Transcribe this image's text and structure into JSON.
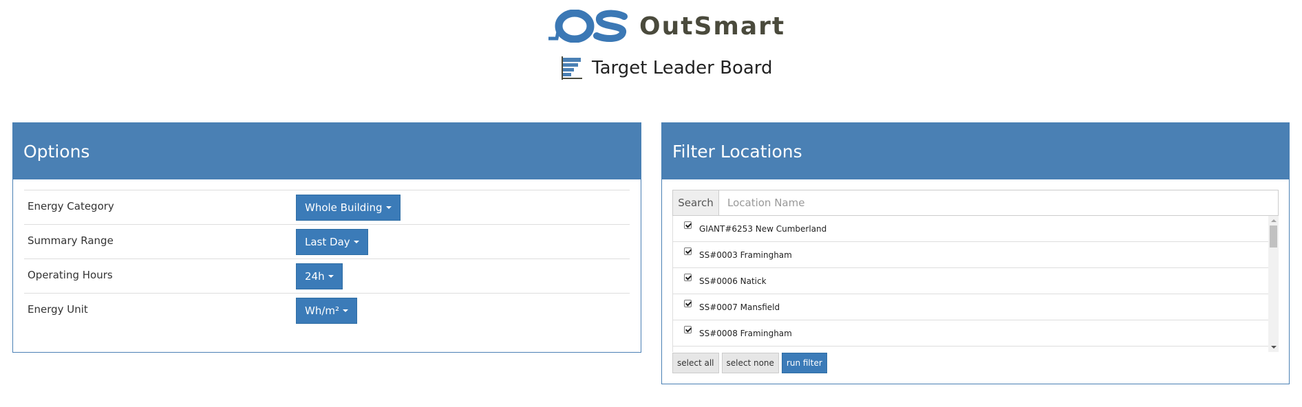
{
  "brand": {
    "name": "OutSmart",
    "logo_icon": "outsmart-os-logo",
    "color": "#4a80b4"
  },
  "page": {
    "title": "Target Leader Board",
    "title_icon": "leaderboard-icon"
  },
  "options": {
    "heading": "Options",
    "rows": [
      {
        "label": "Energy Category",
        "value": "Whole Building"
      },
      {
        "label": "Summary Range",
        "value": "Last Day"
      },
      {
        "label": "Operating Hours",
        "value": "24h"
      },
      {
        "label": "Energy Unit",
        "value": "Wh/m²"
      }
    ]
  },
  "filter": {
    "heading": "Filter Locations",
    "search_label": "Search",
    "search_placeholder": "Location Name",
    "locations": [
      {
        "name": "GIANT#6253 New Cumberland",
        "checked": true
      },
      {
        "name": "SS#0003 Framingham",
        "checked": true
      },
      {
        "name": "SS#0006 Natick",
        "checked": true
      },
      {
        "name": "SS#0007 Mansfield",
        "checked": true
      },
      {
        "name": "SS#0008 Framingham",
        "checked": true
      }
    ],
    "select_all_label": "select all",
    "select_none_label": "select none",
    "run_filter_label": "run filter"
  }
}
